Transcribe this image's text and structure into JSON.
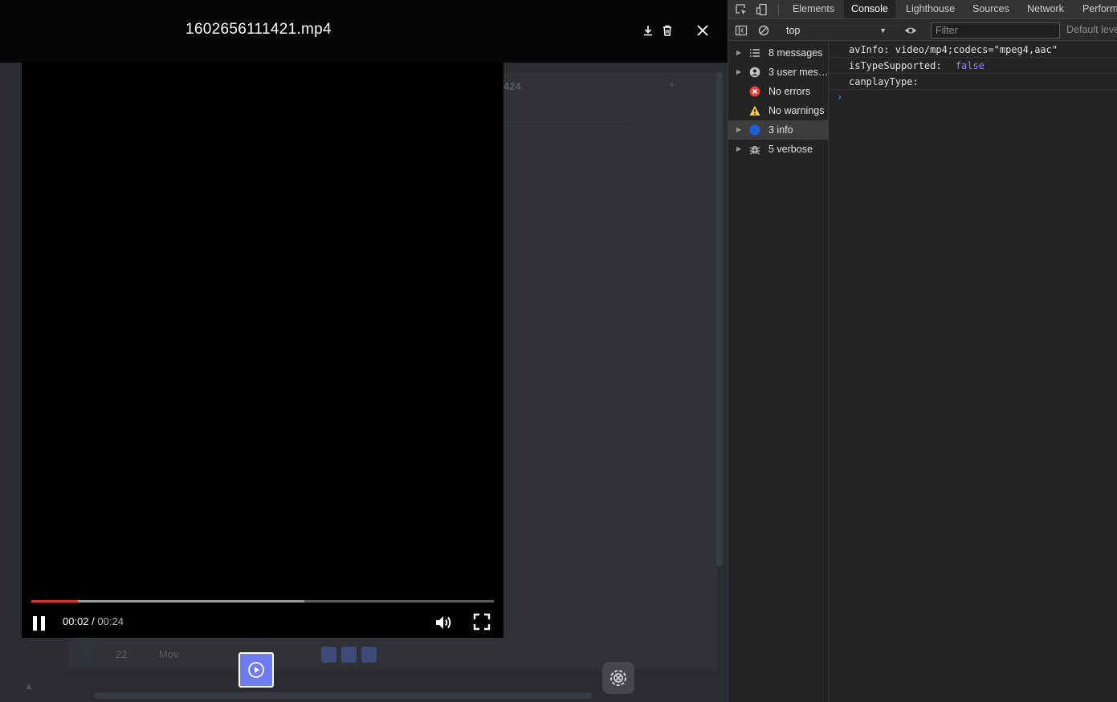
{
  "viewer": {
    "file_name": "1602656111421.mp4",
    "icons": {
      "download": "download-icon",
      "delete": "trash-icon",
      "close": "close-icon"
    }
  },
  "player": {
    "current_time": "00:02",
    "separator": " / ",
    "duration": "00:24",
    "played_fraction": 0.1,
    "buffered_fraction": 0.59,
    "progress_color": "#e52d27",
    "icons": {
      "pause": "pause-icon",
      "volume": "volume-icon",
      "fullscreen": "fullscreen-icon"
    }
  },
  "background_page": {
    "number_fragment": "424",
    "row_number": "22",
    "row_text": "Mov",
    "thumbnail_color": "#6e7cf2"
  },
  "devtools": {
    "tabs": [
      {
        "label": "Elements"
      },
      {
        "label": "Console",
        "active": true
      },
      {
        "label": "Lighthouse"
      },
      {
        "label": "Sources"
      },
      {
        "label": "Network"
      },
      {
        "label": "Perform"
      }
    ],
    "context": "top",
    "filter_placeholder": "Filter",
    "levels_label": "Default levels",
    "sidebar": [
      {
        "label": "8 messages",
        "icon": "list-icon"
      },
      {
        "label": "3 user mes…",
        "icon": "user-icon"
      },
      {
        "label": "No errors",
        "icon": "error-icon"
      },
      {
        "label": "No warnings",
        "icon": "warning-icon"
      },
      {
        "label": "3 info",
        "icon": "info-icon",
        "selected": true
      },
      {
        "label": "5 verbose",
        "icon": "bug-icon"
      }
    ],
    "console_lines": [
      {
        "text": "avInfo: video/mp4;codecs=\"mpeg4,aac\"",
        "value": ""
      },
      {
        "text": "isTypeSupported: ",
        "value": "false"
      },
      {
        "text": "canplayType: ",
        "value": ""
      }
    ],
    "prompt_symbol": "›"
  }
}
